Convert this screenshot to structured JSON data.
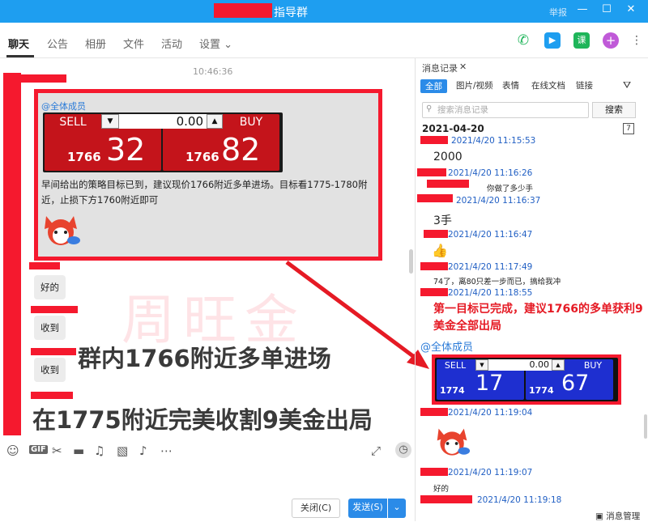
{
  "title_bar": {
    "title": "指导群",
    "report": "举报",
    "minimize": "—",
    "maximize": "☐",
    "close": "✕"
  },
  "tabs": [
    {
      "label": "聊天"
    },
    {
      "label": "公告"
    },
    {
      "label": "相册"
    },
    {
      "label": "文件"
    },
    {
      "label": "活动"
    },
    {
      "label": "设置 ⌄"
    }
  ],
  "chat": {
    "timestamp": "10:46:36",
    "mention": "@全体成员",
    "trade_widget": {
      "sell_label": "SELL",
      "buy_label": "BUY",
      "quantity": "0.00",
      "sell_base": "1766",
      "sell_pips": "32",
      "buy_base": "1766",
      "buy_pips": "82"
    },
    "message": "早间给出的策略目标已到，建议现价1766附近多单进场。目标看1775-1780附近，止损下方1760附近即可",
    "replies": [
      "好的",
      "收到",
      "收到"
    ],
    "watermark": "周旺金",
    "overlay_line1": "群内1766附近多单进场",
    "overlay_line2": "在1775附近完美收割9美金出局"
  },
  "bottom": {
    "close_label": "关闭(C)",
    "send_label": "发送(S)"
  },
  "history": {
    "title": "消息记录",
    "close": "✕",
    "filters": [
      "全部",
      "图片/视频",
      "表情",
      "在线文档",
      "链接"
    ],
    "search_placeholder": "搜索消息记录",
    "search_button": "搜索",
    "date": "2021-04-20",
    "calendar_day": "7",
    "entries": [
      {
        "time": "2021/4/20 11:15:53"
      },
      {
        "time": "2021/4/20 11:16:26",
        "text": "2000"
      },
      {
        "time": "2021/4/20 11:16:37",
        "text": "你做了多少手"
      },
      {
        "time": "2021/4/20 11:16:47",
        "text": "3手"
      },
      {
        "time": "2021/4/20 11:17:49"
      },
      {
        "time": "2021/4/20 11:18:55",
        "text": "74了，离80只差一步而已，搞给我冲"
      },
      {
        "time": "2021/4/20 11:19:04"
      },
      {
        "time": "2021/4/20 11:19:07"
      },
      {
        "time": "2021/4/20 11:19:18",
        "text": "好的"
      }
    ],
    "callout": "第一目标已完成，建议1766的多单获利9美金全部出局",
    "mention": "@全体成员",
    "trade_widget": {
      "sell_label": "SELL",
      "buy_label": "BUY",
      "quantity": "0.00",
      "sell_base": "1774",
      "sell_pips": "17",
      "buy_base": "1774",
      "buy_pips": "67"
    },
    "manage": "消息管理"
  },
  "colors": {
    "title_bar": "#1e9ef0",
    "redaction": "#f5192e",
    "send_button": "#2b8be8",
    "sell_red": "#c4141b",
    "buy_blue": "#1e2fd0"
  }
}
